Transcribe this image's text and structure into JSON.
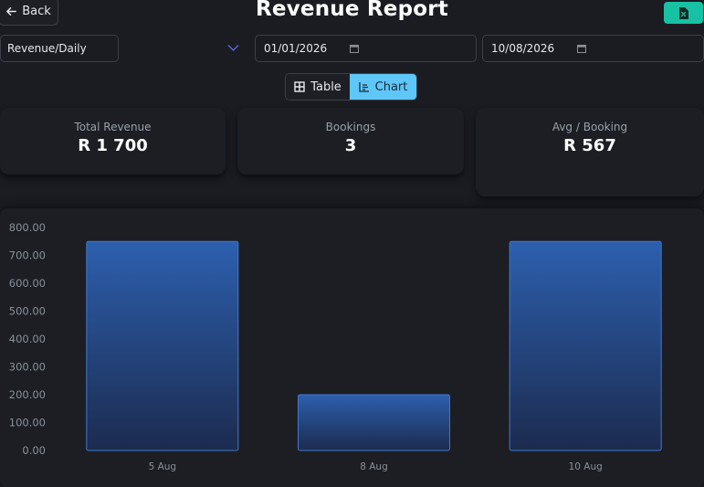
{
  "header": {
    "back_label": "Back",
    "title": "Revenue Report",
    "export_icon": "excel-file-icon"
  },
  "filters": {
    "report_type": "Revenue/Daily",
    "date_from": "01/01/2026",
    "date_to": "10/08/2026"
  },
  "view_toggle": {
    "table_label": "Table",
    "chart_label": "Chart",
    "active": "Chart"
  },
  "stats": {
    "total_revenue_label": "Total Revenue",
    "total_revenue_value": "R 1 700",
    "bookings_label": "Bookings",
    "bookings_value": "3",
    "avg_label": "Avg / Booking",
    "avg_value": "R 567"
  },
  "colors": {
    "accent": "#16c2a3",
    "toggle_active": "#5fc7f7",
    "bar_top": "#2d5fae",
    "bar_bottom": "#1c2b4f"
  },
  "chart_data": {
    "type": "bar",
    "categories": [
      "5 Aug",
      "8 Aug",
      "10 Aug"
    ],
    "values": [
      750,
      200,
      750
    ],
    "yticks": [
      "0.00",
      "100.00",
      "200.00",
      "300.00",
      "400.00",
      "500.00",
      "600.00",
      "700.00",
      "800.00"
    ],
    "ylim": [
      0,
      800
    ],
    "grid": false
  }
}
